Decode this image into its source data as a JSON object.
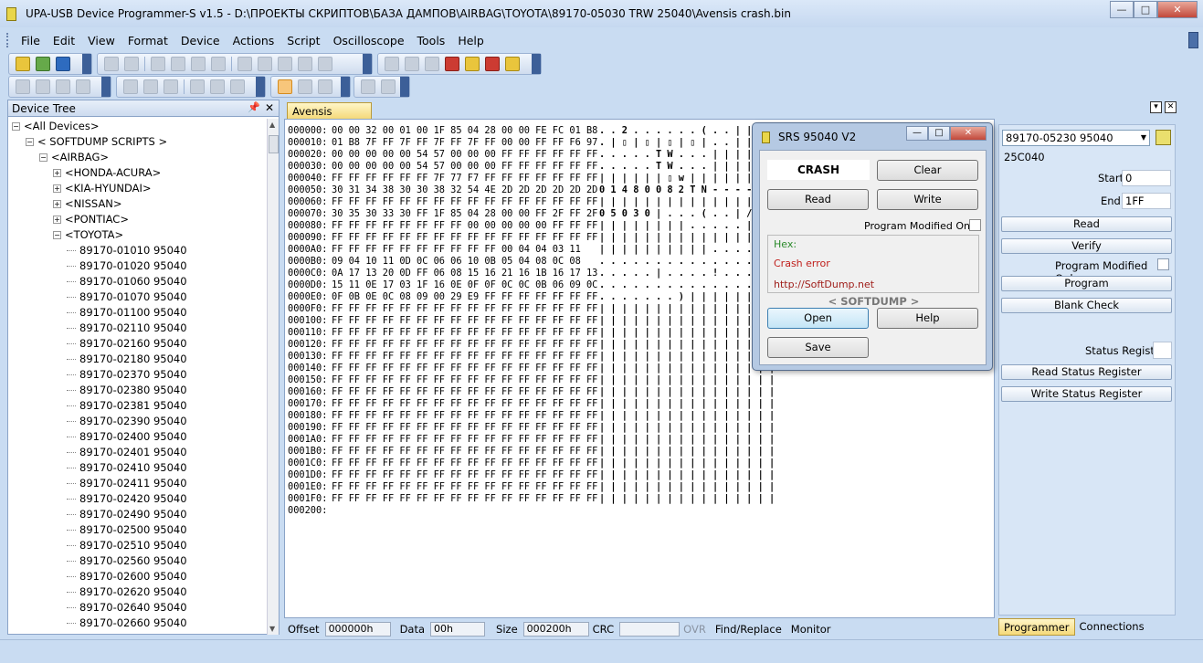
{
  "window": {
    "title": "UPA-USB Device Programmer-S v1.5 - D:\\ПРОЕКТЫ СКРИПТОВ\\БАЗА ДАМПОВ\\AIRBAG\\TOYOTA\\89170-05030 TRW 25040\\Avensis crash.bin",
    "min": "—",
    "max": "□",
    "close": "✕"
  },
  "menu": [
    "File",
    "Edit",
    "View",
    "Format",
    "Device",
    "Actions",
    "Script",
    "Oscilloscope",
    "Tools",
    "Help"
  ],
  "device_tree": {
    "title": "Device Tree",
    "pin": "📌",
    "close": "✕",
    "items": [
      {
        "label": "<All Devices>",
        "indent": 0,
        "exp": "−"
      },
      {
        "label": "< SOFTDUMP SCRIPTS >",
        "indent": 1,
        "exp": "−"
      },
      {
        "label": "<AIRBAG>",
        "indent": 2,
        "exp": "−"
      },
      {
        "label": "<HONDA-ACURA>",
        "indent": 3,
        "exp": "+"
      },
      {
        "label": "<KIA-HYUNDAI>",
        "indent": 3,
        "exp": "+"
      },
      {
        "label": "<NISSAN>",
        "indent": 3,
        "exp": "+"
      },
      {
        "label": "<PONTIAC>",
        "indent": 3,
        "exp": "+"
      },
      {
        "label": "<TOYOTA>",
        "indent": 3,
        "exp": "−"
      },
      {
        "label": "89170-01010 95040",
        "indent": 4,
        "exp": ""
      },
      {
        "label": "89170-01020 95040",
        "indent": 4,
        "exp": ""
      },
      {
        "label": "89170-01060 95040",
        "indent": 4,
        "exp": ""
      },
      {
        "label": "89170-01070 95040",
        "indent": 4,
        "exp": ""
      },
      {
        "label": "89170-01100 95040",
        "indent": 4,
        "exp": ""
      },
      {
        "label": "89170-02110 95040",
        "indent": 4,
        "exp": ""
      },
      {
        "label": "89170-02160 95040",
        "indent": 4,
        "exp": ""
      },
      {
        "label": "89170-02180 95040",
        "indent": 4,
        "exp": ""
      },
      {
        "label": "89170-02370 95040",
        "indent": 4,
        "exp": ""
      },
      {
        "label": "89170-02380 95040",
        "indent": 4,
        "exp": ""
      },
      {
        "label": "89170-02381 95040",
        "indent": 4,
        "exp": ""
      },
      {
        "label": "89170-02390 95040",
        "indent": 4,
        "exp": ""
      },
      {
        "label": "89170-02400 95040",
        "indent": 4,
        "exp": ""
      },
      {
        "label": "89170-02401 95040",
        "indent": 4,
        "exp": ""
      },
      {
        "label": "89170-02410 95040",
        "indent": 4,
        "exp": ""
      },
      {
        "label": "89170-02411 95040",
        "indent": 4,
        "exp": ""
      },
      {
        "label": "89170-02420 95040",
        "indent": 4,
        "exp": ""
      },
      {
        "label": "89170-02490 95040",
        "indent": 4,
        "exp": ""
      },
      {
        "label": "89170-02500 95040",
        "indent": 4,
        "exp": ""
      },
      {
        "label": "89170-02510 95040",
        "indent": 4,
        "exp": ""
      },
      {
        "label": "89170-02560 95040",
        "indent": 4,
        "exp": ""
      },
      {
        "label": "89170-02600 95040",
        "indent": 4,
        "exp": ""
      },
      {
        "label": "89170-02620 95040",
        "indent": 4,
        "exp": ""
      },
      {
        "label": "89170-02640 95040",
        "indent": 4,
        "exp": ""
      },
      {
        "label": "89170-02660 95040",
        "indent": 4,
        "exp": ""
      }
    ]
  },
  "editor": {
    "tab": "Avensis crash.bin",
    "rows": [
      {
        "off": "000000:",
        "hex": "00 00 32 00 01 00 1F 85 04 28 00 00 FE FC 01 B8",
        "ascii": ". . 2 . . . . . . ( . . | | . |"
      },
      {
        "off": "000010:",
        "hex": "01 B8 7F FF 7F FF 7F FF 7F FF 00 00 FF FF F6 97",
        "ascii": ". | ▯ | ▯ | ▯ | ▯ | . . | | | |"
      },
      {
        "off": "000020:",
        "hex": "00 00 00 00 00 54 57 00 00 00 FF FF FF FF FF FF",
        "ascii": ". . . . . T W . . . | | | | | |"
      },
      {
        "off": "000030:",
        "hex": "00 00 00 00 00 54 57 00 00 00 FF FF FF FF FF FF",
        "ascii": ". . . . . T W . . . | | | | | |"
      },
      {
        "off": "000040:",
        "hex": "FF FF FF FF FF FF 7F 77 F7 FF FF FF FF FF FF FF",
        "ascii": "| | | | | | ▯ w | | | | | | | |"
      },
      {
        "off": "000050:",
        "hex": "30 31 34 38 30 30 38 32 54 4E 2D 2D 2D 2D 2D 2D",
        "ascii": "0 1 4 8 0 0 8 2 T N - - - - - -"
      },
      {
        "off": "000060:",
        "hex": "FF FF FF FF FF FF FF FF FF FF FF FF FF FF FF FF",
        "ascii": "| | | | | | | | | | | | | | | |"
      },
      {
        "off": "000070:",
        "hex": "30 35 30 33 30 FF 1F 85 04 28 00 00 FF 2F FF 2F",
        "ascii": "0 5 0 3 0 | . . . ( . . | / | /"
      },
      {
        "off": "000080:",
        "hex": "FF FF FF FF FF FF FF FF 00 00 00 00 00 FF FF FF",
        "ascii": "| | | | | | | | . . . . . | | |"
      },
      {
        "off": "000090:",
        "hex": "FF FF FF FF FF FF FF FF FF FF FF FF FF FF FF FF",
        "ascii": "| | | | | | | | | | | | | | | |"
      },
      {
        "off": "0000A0:",
        "hex": "FF FF FF FF FF FF FF FF FF FF 00 04 04 03 11",
        "ascii": "| | | | | | | | | | . . . . ."
      },
      {
        "off": "0000B0:",
        "hex": "09 04 10 11 0D 0C 06 06 10 0B 05 04 08 0C 08",
        "ascii": ". . . . . . . . . . . . . . ."
      },
      {
        "off": "0000C0:",
        "hex": "0A 17 13 20 0D FF 06 08 15 16 21 16 1B 16 17 13",
        "ascii": ". . . . . | . . . . ! . . . . ."
      },
      {
        "off": "0000D0:",
        "hex": "15 11 0E 17 03 1F 16 0E 0F 0F 0C 0C 0B 06 09 0C",
        "ascii": ". . . . . . . . . . . . . . . ."
      },
      {
        "off": "0000E0:",
        "hex": "0F 0B 0E 0C 08 09 00 29 E9 FF FF FF FF FF FF FF",
        "ascii": ". . . . . . . ) | | | | | | | |"
      },
      {
        "off": "0000F0:",
        "hex": "FF FF FF FF FF FF FF FF FF FF FF FF FF FF FF FF",
        "ascii": "| | | | | | | | | | | | | | | |"
      },
      {
        "off": "000100:",
        "hex": "FF FF FF FF FF FF FF FF FF FF FF FF FF FF FF FF",
        "ascii": "| | | | | | | | | | | | | | | |"
      },
      {
        "off": "000110:",
        "hex": "FF FF FF FF FF FF FF FF FF FF FF FF FF FF FF FF",
        "ascii": "| | | | | | | | | | | | | | | |"
      },
      {
        "off": "000120:",
        "hex": "FF FF FF FF FF FF FF FF FF FF FF FF FF FF FF FF",
        "ascii": "| | | | | | | | | | | | | | | |"
      },
      {
        "off": "000130:",
        "hex": "FF FF FF FF FF FF FF FF FF FF FF FF FF FF FF FF",
        "ascii": "| | | | | | | | | | | | | | | |"
      },
      {
        "off": "000140:",
        "hex": "FF FF FF FF FF FF FF FF FF FF FF FF FF FF FF FF",
        "ascii": "| | | | | | | | | | | | | | | |"
      },
      {
        "off": "000150:",
        "hex": "FF FF FF FF FF FF FF FF FF FF FF FF FF FF FF FF",
        "ascii": "| | | | | | | | | | | | | | | |"
      },
      {
        "off": "000160:",
        "hex": "FF FF FF FF FF FF FF FF FF FF FF FF FF FF FF FF",
        "ascii": "| | | | | | | | | | | | | | | |"
      },
      {
        "off": "000170:",
        "hex": "FF FF FF FF FF FF FF FF FF FF FF FF FF FF FF FF",
        "ascii": "| | | | | | | | | | | | | | | |"
      },
      {
        "off": "000180:",
        "hex": "FF FF FF FF FF FF FF FF FF FF FF FF FF FF FF FF",
        "ascii": "| | | | | | | | | | | | | | | |"
      },
      {
        "off": "000190:",
        "hex": "FF FF FF FF FF FF FF FF FF FF FF FF FF FF FF FF",
        "ascii": "| | | | | | | | | | | | | | | |"
      },
      {
        "off": "0001A0:",
        "hex": "FF FF FF FF FF FF FF FF FF FF FF FF FF FF FF FF",
        "ascii": "| | | | | | | | | | | | | | | |"
      },
      {
        "off": "0001B0:",
        "hex": "FF FF FF FF FF FF FF FF FF FF FF FF FF FF FF FF",
        "ascii": "| | | | | | | | | | | | | | | |"
      },
      {
        "off": "0001C0:",
        "hex": "FF FF FF FF FF FF FF FF FF FF FF FF FF FF FF FF",
        "ascii": "| | | | | | | | | | | | | | | |"
      },
      {
        "off": "0001D0:",
        "hex": "FF FF FF FF FF FF FF FF FF FF FF FF FF FF FF FF",
        "ascii": "| | | | | | | | | | | | | | | |"
      },
      {
        "off": "0001E0:",
        "hex": "FF FF FF FF FF FF FF FF FF FF FF FF FF FF FF FF",
        "ascii": "| | | | | | | | | | | | | | | |"
      },
      {
        "off": "0001F0:",
        "hex": "FF FF FF FF FF FF FF FF FF FF FF FF FF FF FF FF",
        "ascii": "| | | | | | | | | | | | | | | |"
      },
      {
        "off": "000200:",
        "hex": "",
        "ascii": ""
      }
    ]
  },
  "statusbar": {
    "offset_label": "Offset",
    "offset_value": "000000h",
    "data_label": "Data",
    "data_value": "00h",
    "size_label": "Size",
    "size_value": "000200h",
    "crc_label": "CRC",
    "crc_value": "",
    "ovr": "OVR",
    "find_replace": "Find/Replace",
    "monitor": "Monitor"
  },
  "programmer": {
    "device": "89170-05230 95040",
    "chip": "25C040",
    "start_label": "Start",
    "start_value": "0",
    "end_label": "End",
    "end_value": "1FF",
    "read": "Read",
    "verify": "Verify",
    "pm_only": "Program Modified Only",
    "program": "Program",
    "blank_check": "Blank Check",
    "status_register": "Status Register",
    "read_sr": "Read Status Register",
    "write_sr": "Write Status Register",
    "tab_programmer": "Programmer",
    "tab_connections": "Connections"
  },
  "dialog": {
    "title": "SRS 95040 V2",
    "crash": "CRASH",
    "clear": "Clear",
    "read": "Read",
    "write": "Write",
    "pm_only": "Program Modified Only",
    "log_hex": "Hex:",
    "log_crash": "Crash error",
    "log_url": "http://SoftDump.net",
    "brand": "< SOFTDUMP >",
    "open": "Open",
    "help": "Help",
    "save": "Save"
  },
  "colors": {
    "log_hex": "#2a8a2a",
    "log_crash": "#c0201c",
    "log_url": "#a0201c"
  }
}
